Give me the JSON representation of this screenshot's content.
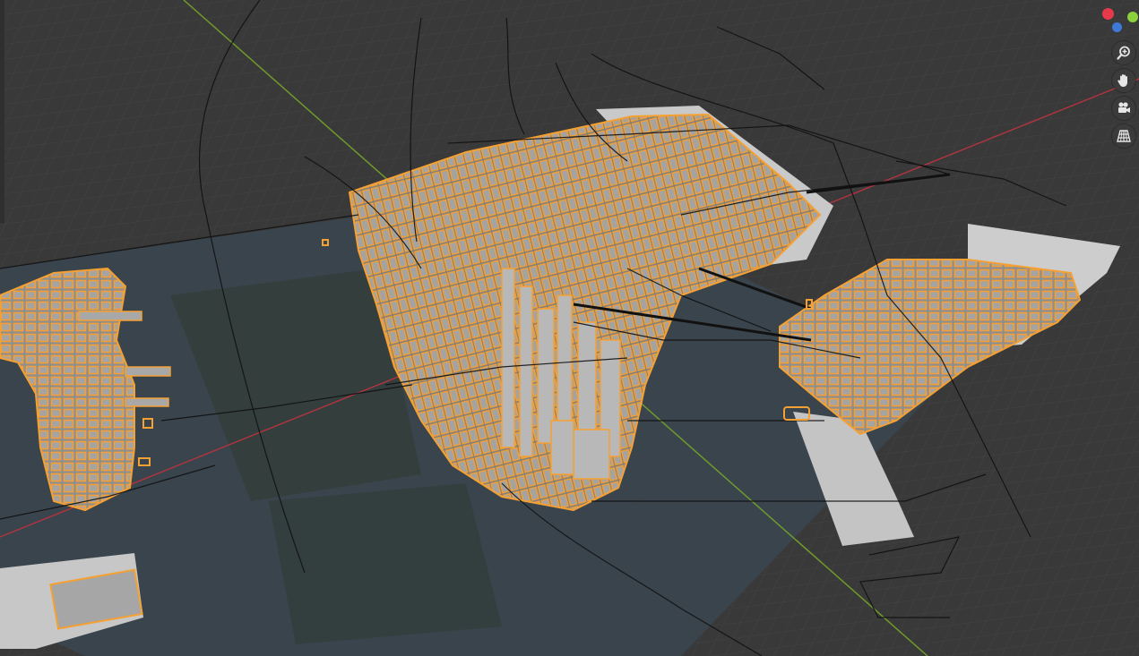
{
  "viewport": {
    "mode": "3D viewport",
    "colors": {
      "background": "#393939",
      "grid": "#4a4a4a",
      "x_axis": "#c0404d",
      "y_axis": "#7aa636",
      "selection_outline": "#f5a033",
      "building": "#9a9a9a",
      "water_plane": "#3a4650"
    }
  },
  "navigation_gizmo": {
    "axes": [
      {
        "name": "x-axis-dot",
        "color": "#e63a4b"
      },
      {
        "name": "y-axis-dot",
        "color": "#8bd13b"
      },
      {
        "name": "z-axis-dot",
        "color": "#3e79d8"
      }
    ],
    "buttons": [
      {
        "name": "zoom-button",
        "icon": "magnifier-plus-icon"
      },
      {
        "name": "pan-button",
        "icon": "hand-icon"
      },
      {
        "name": "camera-view-button",
        "icon": "camera-icon"
      },
      {
        "name": "perspective-toggle-button",
        "icon": "grid-perspective-icon"
      }
    ]
  }
}
